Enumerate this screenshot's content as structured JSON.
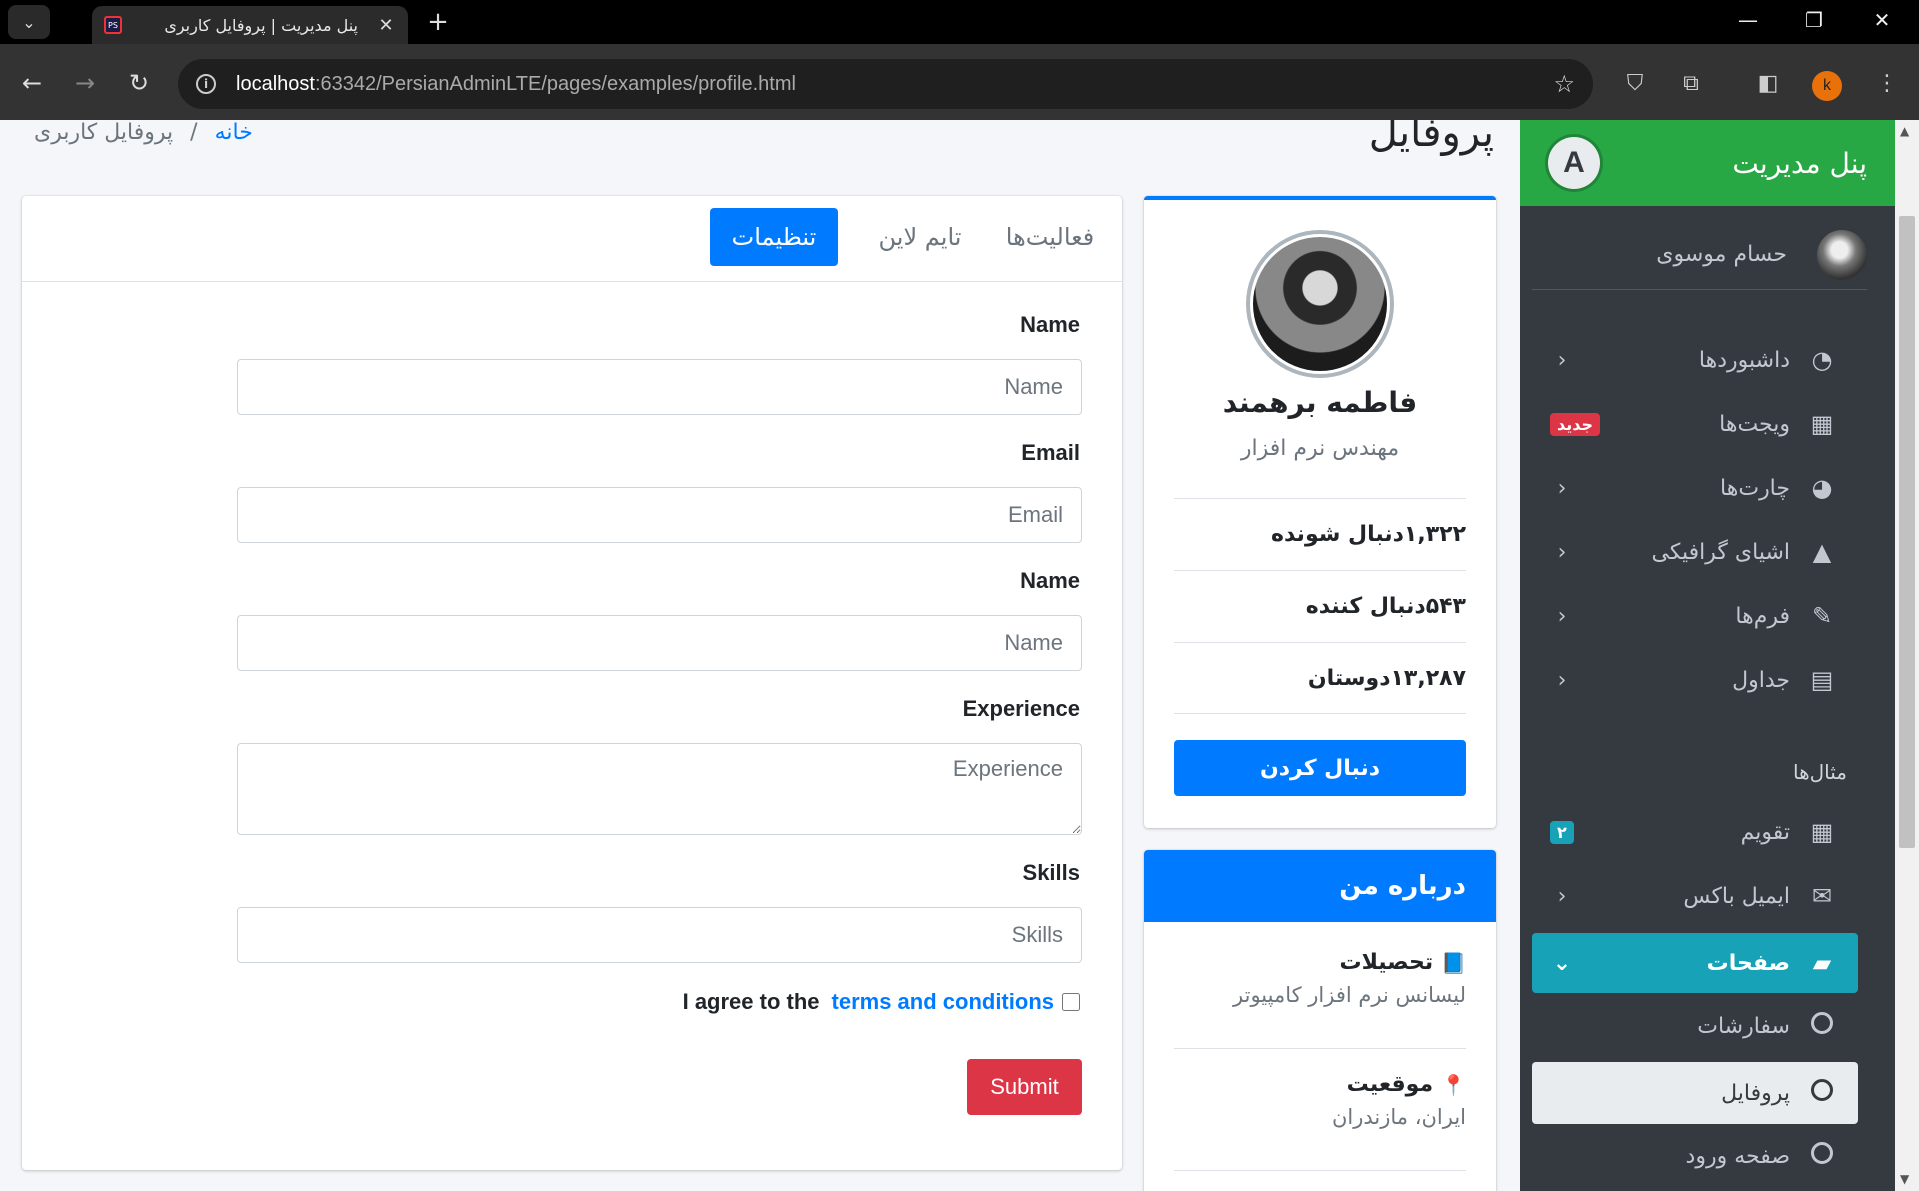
{
  "browser": {
    "tab_title": "پنل مدیریت | پروفایل کاربری",
    "url_host": "localhost",
    "url_rest": ":63342/PersianAdminLTE/pages/examples/profile.html",
    "profile_initial": "k"
  },
  "header": {
    "page_title": "پروفایل",
    "breadcrumb_home": "خانه",
    "breadcrumb_sep": "/",
    "breadcrumb_current": "پروفایل کاربری"
  },
  "tabs": {
    "activity": "فعالیت‌ها",
    "timeline": "تایم لاین",
    "settings": "تنظیمات"
  },
  "form": {
    "name_label": "Name",
    "name_placeholder": "Name",
    "email_label": "Email",
    "email_placeholder": "Email",
    "name2_label": "Name",
    "name2_placeholder": "Name",
    "experience_label": "Experience",
    "experience_placeholder": "Experience",
    "skills_label": "Skills",
    "skills_placeholder": "Skills",
    "agree_text": "I agree to the",
    "terms_link": "terms and conditions",
    "submit": "Submit"
  },
  "profile": {
    "name": "فاطمه برهمند",
    "job": "مهندس نرم افزار",
    "followers_label": "دنبال شونده",
    "followers_value": "۱,۳۲۲",
    "following_label": "دنبال کننده",
    "following_value": "۵۴۳",
    "friends_label": "دوستان",
    "friends_value": "۱۳,۲۸۷",
    "follow_button": "دنبال کردن"
  },
  "about": {
    "title": "درباره من",
    "education_label": "تحصیلات",
    "education_value": "لیسانس نرم افزار کامپیوتر",
    "location_label": "موقعیت",
    "location_value": "ایران، مازندران"
  },
  "sidebar": {
    "brand": "پنل مدیریت",
    "brand_logo": "A",
    "user_name": "حسام موسوی",
    "items": [
      {
        "label": "داشبوردها",
        "icon": "dashboard-icon"
      },
      {
        "label": "ویجت‌ها",
        "icon": "grid-icon",
        "badge": "جدید"
      },
      {
        "label": "چارت‌ها",
        "icon": "pie-chart-icon"
      },
      {
        "label": "اشیای گرافیکی",
        "icon": "tree-icon"
      },
      {
        "label": "فرم‌ها",
        "icon": "edit-icon"
      },
      {
        "label": "جداول",
        "icon": "table-icon"
      }
    ],
    "section_header": "مثال‌ها",
    "examples": [
      {
        "label": "تقویم",
        "icon": "calendar-icon",
        "badge": "۲"
      },
      {
        "label": "ایمیل باکس",
        "icon": "envelope-icon"
      },
      {
        "label": "صفحات",
        "icon": "book-icon"
      },
      {
        "label": "سفارشات",
        "icon": "circle-icon"
      },
      {
        "label": "پروفایل",
        "icon": "circle-icon"
      },
      {
        "label": "صفحه ورود",
        "icon": "circle-icon"
      }
    ]
  },
  "colors": {
    "primary": "#007bff",
    "brand_green": "#28a745",
    "sidebar_bg": "#343a40",
    "active_teal": "#17a2b8",
    "danger": "#dc3545"
  }
}
